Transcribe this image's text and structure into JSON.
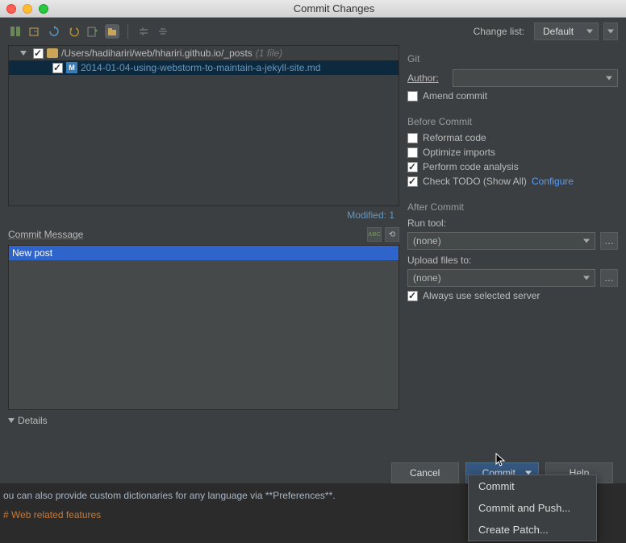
{
  "window": {
    "title": "Commit Changes"
  },
  "toolbar": {
    "change_list_label": "Change list:",
    "change_list_value": "Default"
  },
  "tree": {
    "folder_path": "/Users/hadihariri/web/hhariri.github.io/_posts",
    "folder_hint": "(1 file)",
    "file_icon_text": "M",
    "file_name": "2014-01-04-using-webstorm-to-maintain-a-jekyll-site.md"
  },
  "status": {
    "modified_label": "Modified: 1"
  },
  "commit_msg": {
    "section": "Commit Message",
    "text": "New post"
  },
  "details": {
    "label": "Details"
  },
  "git": {
    "section": "Git",
    "author_label": "Author:",
    "author_value": "",
    "amend_label": "Amend commit"
  },
  "before": {
    "section": "Before Commit",
    "reformat": "Reformat code",
    "optimize": "Optimize imports",
    "analysis": "Perform code analysis",
    "todo": "Check TODO (Show All)",
    "configure": "Configure"
  },
  "after": {
    "section": "After Commit",
    "run_tool_label": "Run tool:",
    "run_tool_value": "(none)",
    "upload_label": "Upload files to:",
    "upload_value": "(none)",
    "always_server": "Always use selected server"
  },
  "buttons": {
    "cancel": "Cancel",
    "commit": "Commit",
    "help": "Help"
  },
  "popup": {
    "commit": "Commit",
    "commit_push": "Commit and Push...",
    "create_patch": "Create Patch..."
  },
  "editor": {
    "line1": "ou can also provide custom dictionaries for any language via **Preferences**.",
    "line2": "# Web related features"
  },
  "icons": {
    "spellcheck": "ABC",
    "history": "⟲",
    "ellipsis": "…"
  }
}
